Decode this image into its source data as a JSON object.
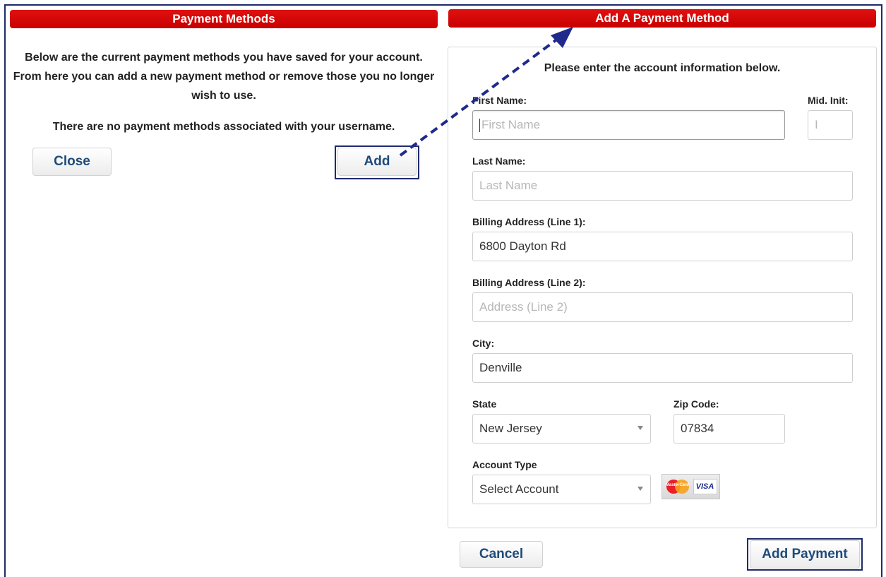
{
  "left_panel": {
    "title": "Payment Methods",
    "intro": "Below are the current payment methods you have saved for your account. From here you can add a new payment method or remove those you no longer wish to use.",
    "no_methods": "There are no payment methods associated with your username.",
    "close_label": "Close",
    "add_label": "Add"
  },
  "right_panel": {
    "title": "Add A Payment Method",
    "instructions": "Please enter the account information below.",
    "fields": {
      "first_name": {
        "label": "First Name:",
        "value": "",
        "placeholder": "First Name"
      },
      "mid_init": {
        "label": "Mid. Init:",
        "value": "",
        "placeholder": "I"
      },
      "last_name": {
        "label": "Last Name:",
        "value": "",
        "placeholder": "Last Name"
      },
      "address1": {
        "label": "Billing Address (Line 1):",
        "value": "6800 Dayton Rd",
        "placeholder": ""
      },
      "address2": {
        "label": "Billing Address (Line 2):",
        "value": "",
        "placeholder": "Address (Line 2)"
      },
      "city": {
        "label": "City:",
        "value": "Denville",
        "placeholder": ""
      },
      "state": {
        "label": "State",
        "selected": "New Jersey"
      },
      "zip": {
        "label": "Zip Code:",
        "value": "07834"
      },
      "account_type": {
        "label": "Account Type",
        "selected": "Select Account"
      }
    },
    "cards": {
      "mastercard_text": "MasterCard",
      "visa_text": "VISA"
    },
    "cancel_label": "Cancel",
    "add_payment_label": "Add Payment"
  },
  "annotation": {
    "arrow_color": "#1f2a8c",
    "highlight_color": "#1f2a6b"
  },
  "colors": {
    "header_red": "#d40000",
    "button_text": "#1f4a7a"
  }
}
